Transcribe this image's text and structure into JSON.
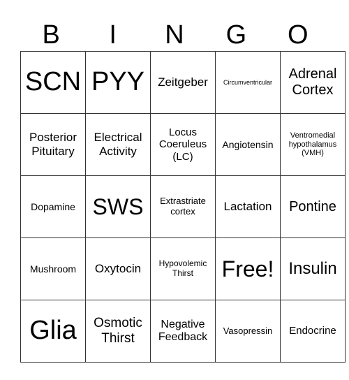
{
  "header": [
    "B",
    "I",
    "N",
    "G",
    "O"
  ],
  "rows": [
    [
      {
        "t": "SCN",
        "s": 38
      },
      {
        "t": "PYY",
        "s": 38
      },
      {
        "t": "Zeitgeber",
        "s": 17
      },
      {
        "t": "Circumventricular",
        "s": 9
      },
      {
        "t": "Adrenal Cortex",
        "s": 20
      }
    ],
    [
      {
        "t": "Posterior Pituitary",
        "s": 17
      },
      {
        "t": "Electrical Activity",
        "s": 17
      },
      {
        "t": "Locus Coeruleus (LC)",
        "s": 15
      },
      {
        "t": "Angiotensin",
        "s": 14
      },
      {
        "t": "Ventromedial hypothalamus (VMH)",
        "s": 11
      }
    ],
    [
      {
        "t": "Dopamine",
        "s": 14
      },
      {
        "t": "SWS",
        "s": 32
      },
      {
        "t": "Extrastriate cortex",
        "s": 13
      },
      {
        "t": "Lactation",
        "s": 17
      },
      {
        "t": "Pontine",
        "s": 20
      }
    ],
    [
      {
        "t": "Mushroom",
        "s": 14
      },
      {
        "t": "Oxytocin",
        "s": 17
      },
      {
        "t": "Hypovolemic Thirst",
        "s": 12
      },
      {
        "t": "Free!",
        "s": 32
      },
      {
        "t": "Insulin",
        "s": 24
      }
    ],
    [
      {
        "t": "Glia",
        "s": 38
      },
      {
        "t": "Osmotic Thirst",
        "s": 19
      },
      {
        "t": "Negative Feedback",
        "s": 16
      },
      {
        "t": "Vasopressin",
        "s": 13
      },
      {
        "t": "Endocrine",
        "s": 15
      }
    ]
  ]
}
